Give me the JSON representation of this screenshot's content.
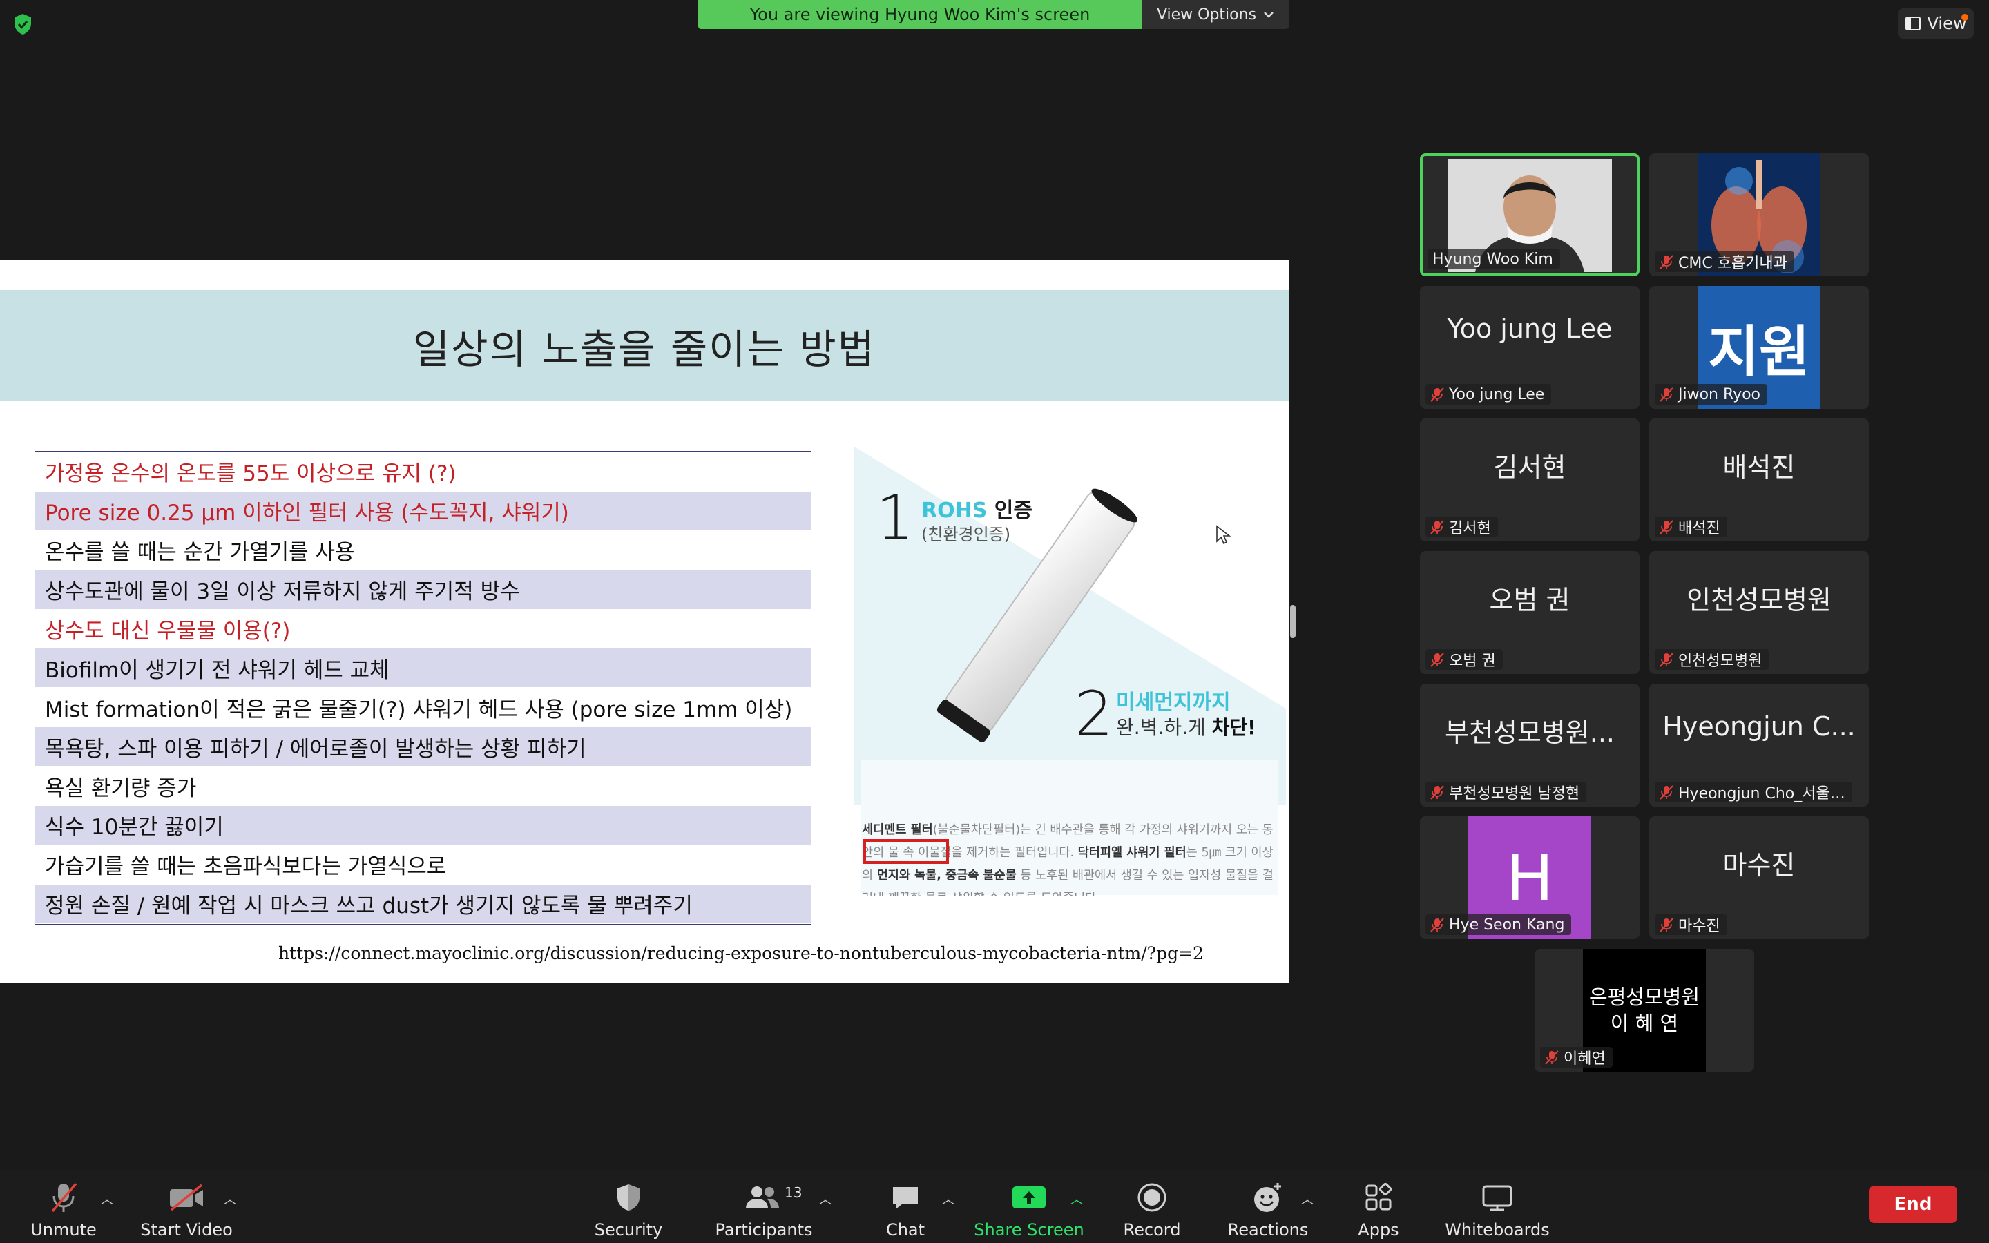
{
  "share_banner": "You are viewing Hyung Woo Kim's screen",
  "view_options_label": "View Options",
  "view_label": "View",
  "slide": {
    "title": "일상의 노출을 줄이는 방법",
    "tips": [
      {
        "text": "가정용 온수의 온도를 55도 이상으로 유지 (?)",
        "red": true,
        "shaded": false
      },
      {
        "text": "Pore size 0.25 µm 이하인 필터 사용 (수도꼭지, 샤워기)",
        "red": true,
        "shaded": true
      },
      {
        "text": "온수를 쓸 때는 순간 가열기를 사용",
        "red": false,
        "shaded": false
      },
      {
        "text": "상수도관에 물이 3일 이상 저류하지 않게 주기적 방수",
        "red": false,
        "shaded": true
      },
      {
        "text": "상수도 대신 우물물 이용(?)",
        "red": true,
        "shaded": false
      },
      {
        "text": "Biofilm이 생기기 전 샤워기 헤드 교체",
        "red": false,
        "shaded": true
      },
      {
        "text": "Mist formation이 적은 굵은 물줄기(?) 샤워기 헤드 사용 (pore size 1mm 이상)",
        "red": false,
        "shaded": false
      },
      {
        "text": "목욕탕, 스파 이용 피하기 / 에어로졸이 발생하는 상황 피하기",
        "red": false,
        "shaded": true
      },
      {
        "text": "욕실 환기량 증가",
        "red": false,
        "shaded": false
      },
      {
        "text": "식수 10분간 끓이기",
        "red": false,
        "shaded": true
      },
      {
        "text": "가습기를 쓸 때는 초음파식보다는 가열식으로",
        "red": false,
        "shaded": false
      },
      {
        "text": "정원 손질 / 원예 작업 시 마스크 쓰고 dust가 생기지 않도록 물 뿌려주기",
        "red": false,
        "shaded": true
      }
    ],
    "url": "https://connect.mayoclinic.org/discussion/reducing-exposure-to-nontuberculous-mycobacteria-ntm/?pg=2",
    "ad": {
      "num1": "1",
      "h1_accent": "ROHS",
      "h1_rest": "인증",
      "sub1": "(친환경인증)",
      "num2": "2",
      "h2": "미세먼지까지",
      "sub2_plain": "완.벽.하.게",
      "sub2_bold": "차단!",
      "desc_b1": "세디멘트 필터",
      "desc_t1": "(불순물차단필터)는 긴 배수관을 통해 각 가정의 샤워기까지 오는 동안의 물 속 이물질을 제거하는 필터입니다.",
      "desc_b2": "닥터피엘 샤워기 필터",
      "desc_t2": "는",
      "desc_box": "5㎛ 크기 이상의",
      "desc_b3": "먼지와 녹물, 중금속 불순물",
      "desc_t3": "등 노후된 배관에서 생길 수 있는 입자성 물질을 걸러내 깨끗한 물로 샤워할 수 있도록 도와줍니다.",
      "accent_color": "#3ec3d8"
    }
  },
  "participants": [
    {
      "name": "Hyung Woo Kim",
      "big": "",
      "muted": false,
      "active": true,
      "kind": "video"
    },
    {
      "name": "CMC 호흡기내과",
      "big": "",
      "muted": true,
      "active": false,
      "kind": "lungs"
    },
    {
      "name": "Yoo jung Lee",
      "big": "Yoo jung Lee",
      "muted": true,
      "active": false,
      "kind": "text"
    },
    {
      "name": "Jiwon Ryoo",
      "big": "지원",
      "muted": true,
      "active": false,
      "kind": "blue"
    },
    {
      "name": "김서현",
      "big": "김서현",
      "muted": true,
      "active": false,
      "kind": "text"
    },
    {
      "name": "배석진",
      "big": "배석진",
      "muted": true,
      "active": false,
      "kind": "text"
    },
    {
      "name": "오범 권",
      "big": "오범 권",
      "muted": true,
      "active": false,
      "kind": "text"
    },
    {
      "name": "인천성모병원",
      "big": "인천성모병원",
      "muted": true,
      "active": false,
      "kind": "text"
    },
    {
      "name": "부천성모병원 남정현",
      "big": "부천성모병원...",
      "muted": true,
      "active": false,
      "kind": "text"
    },
    {
      "name": "Hyeongjun Cho_서울…",
      "big": "Hyeongjun C...",
      "muted": true,
      "active": false,
      "kind": "text"
    },
    {
      "name": "Hye Seon Kang",
      "big": "H",
      "muted": true,
      "active": false,
      "kind": "purple"
    },
    {
      "name": "마수진",
      "big": "마수진",
      "muted": true,
      "active": false,
      "kind": "text"
    },
    {
      "name": "이혜연",
      "big_line1": "은평성모병원",
      "big_line2": "이 혜 연",
      "muted": true,
      "active": false,
      "kind": "black"
    }
  ],
  "toolbar": {
    "unmute": "Unmute",
    "start_video": "Start Video",
    "security": "Security",
    "participants": "Participants",
    "participants_count": "13",
    "chat": "Chat",
    "share_screen": "Share Screen",
    "record": "Record",
    "reactions": "Reactions",
    "apps": "Apps",
    "whiteboards": "Whiteboards",
    "end": "End"
  },
  "colors": {
    "banner_green": "#57c85a",
    "end_red": "#d6282d",
    "share_green": "#23d959",
    "active_border": "#4fd15e",
    "mute_red": "#e0403a"
  }
}
